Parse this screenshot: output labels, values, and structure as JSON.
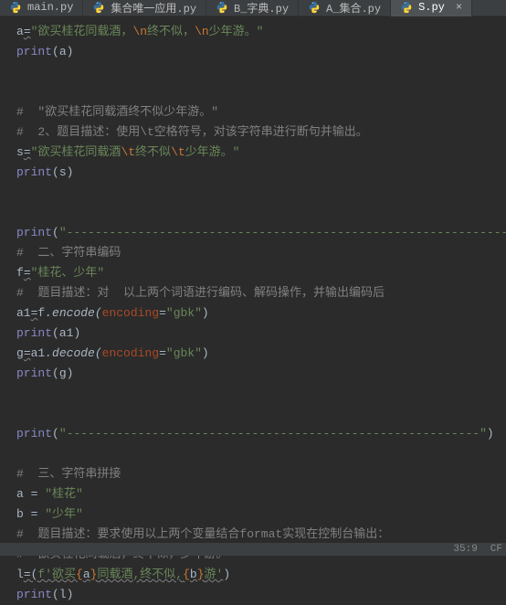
{
  "tabs": [
    {
      "label": "main.py",
      "active": false,
      "close": false
    },
    {
      "label": "集合唯一应用.py",
      "active": false,
      "close": false
    },
    {
      "label": "B_字典.py",
      "active": false,
      "close": false
    },
    {
      "label": "A_集合.py",
      "active": false,
      "close": false
    },
    {
      "label": "S.py",
      "active": true,
      "close": true
    }
  ],
  "code": {
    "l1_var": "a",
    "l1_eq": "=",
    "l1_s1": "\"欲买桂花同载酒，",
    "l1_e1": "\\n",
    "l1_s2": "终不似，",
    "l1_e2": "\\n",
    "l1_s3": "少年游。\"",
    "l2_a": "print",
    "l2_b": "(",
    "l2_c": "a",
    "l2_d": ")",
    "l4": "#  \"欲买桂花同载酒终不似少年游。\"",
    "l5": "#  2、题目描述：使用\\t空格符号，对该字符串进行断句并输出。",
    "l6_var": "s",
    "l6_eq": "=",
    "l6_s1": "\"欲买桂花同载酒",
    "l6_e1": "\\t",
    "l6_s2": "终不似",
    "l6_e2": "\\t",
    "l6_s3": "少年游。\"",
    "l7_a": "print",
    "l7_b": "(",
    "l7_c": "s",
    "l7_d": ")",
    "l9_a": "print",
    "l9_b": "(",
    "l9_c": "\"-----------------------------------------------------------------\"",
    "l9_d": ")",
    "l10": "#  二、字符串编码",
    "l11_var": "f",
    "l11_eq": "=",
    "l11_s": "\"桂花、少年\"",
    "l12": "#  题目描述：对  以上两个词语进行编码、解码操作，并输出编码后",
    "l13_a": "a1",
    "l13_b": "=",
    "l13_c": "f",
    "l13_d": ".encode(",
    "l13_e": "encoding",
    "l13_f": "=",
    "l13_g": "\"gbk\"",
    "l13_h": ")",
    "l14_a": "print",
    "l14_b": "(",
    "l14_c": "a1",
    "l14_d": ")",
    "l15_a": "g",
    "l15_b": "=",
    "l15_c": "a1",
    "l15_d": ".decode(",
    "l15_e": "encoding",
    "l15_f": "=",
    "l15_g": "\"gbk\"",
    "l15_h": ")",
    "l16_a": "print",
    "l16_b": "(",
    "l16_c": "g",
    "l16_d": ")",
    "l18_a": "print",
    "l18_b": "(",
    "l18_c": "\"----------------------------------------------------------\"",
    "l18_d": ")",
    "l20": "#  三、字符串拼接",
    "l21_a": "a ",
    "l21_b": "= ",
    "l21_c": "\"桂花\"",
    "l22_a": "b ",
    "l22_b": "= ",
    "l22_c": "\"少年\"",
    "l23": "#  题目描述：要求使用以上两个变量结合format实现在控制台输出：",
    "l24": "#  欲买桂花同载酒，终不似，少年游。",
    "l25_a": "l",
    "l25_b": "=(",
    "l25_c": "f'欲买",
    "l25_d": "{",
    "l25_e": "a",
    "l25_f": "}",
    "l25_g": "同载酒,终不似,",
    "l25_h": "{",
    "l25_i": "b",
    "l25_j": "}",
    "l25_k": "游'",
    "l25_l": ")",
    "l26_a": "print",
    "l26_b": "(",
    "l26_c": "l",
    "l26_d": ")"
  },
  "status": {
    "pos": "35:9",
    "enc_frag": "CF"
  }
}
